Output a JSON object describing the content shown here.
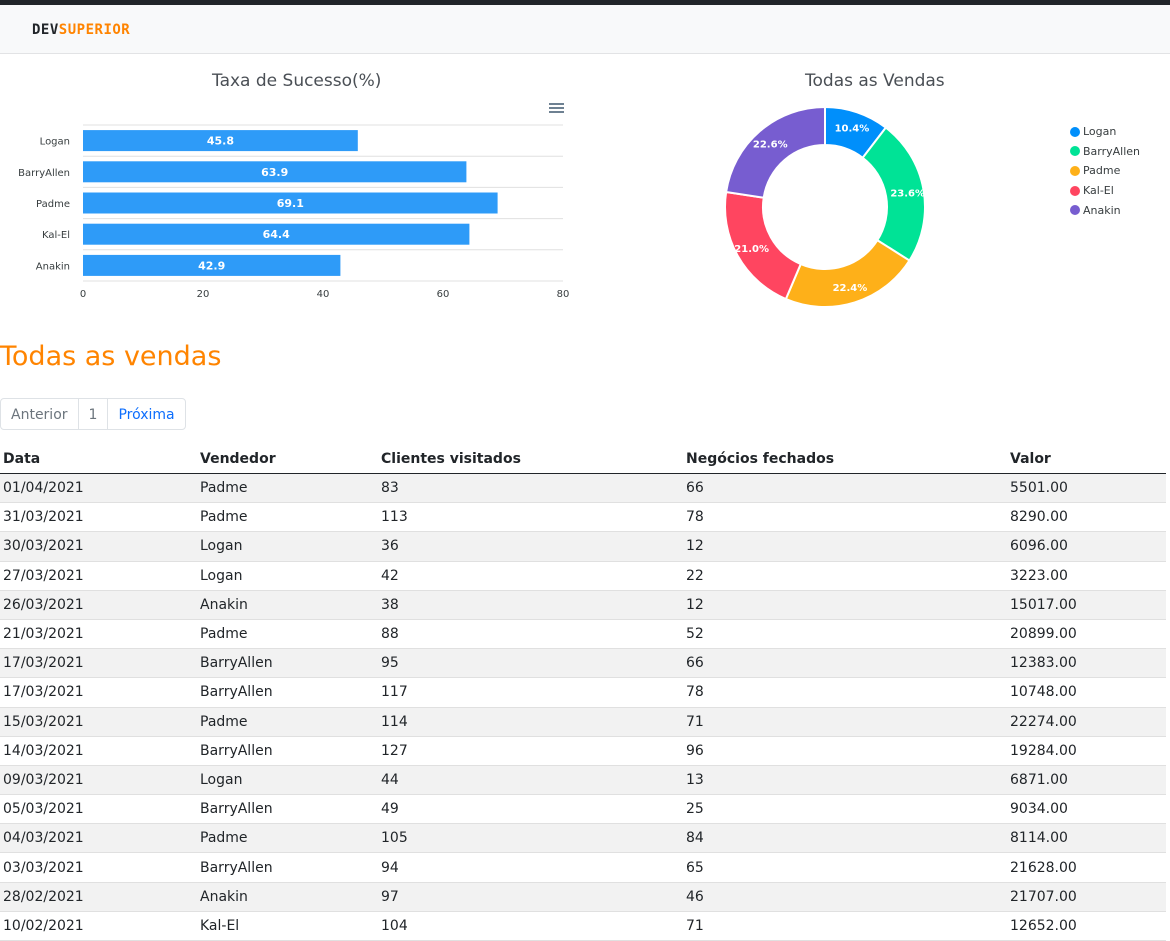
{
  "brand": {
    "part1": "DEV",
    "part2": "SUPERIOR"
  },
  "colors": {
    "accent": "#ff8400",
    "bar": "#2e9bf8"
  },
  "bar_menu_icon": "hamburger-menu-icon",
  "chart_data": [
    {
      "type": "bar",
      "orientation": "horizontal",
      "title": "Taxa de Sucesso(%)",
      "categories": [
        "Logan",
        "BarryAllen",
        "Padme",
        "Kal-El",
        "Anakin"
      ],
      "values": [
        45.8,
        63.9,
        69.1,
        64.4,
        42.9
      ],
      "xlim": [
        0,
        80
      ],
      "xticks": [
        "0",
        "20",
        "40",
        "60",
        "80"
      ],
      "grid": true
    },
    {
      "type": "pie",
      "variant": "donut",
      "title": "Todas as Vendas",
      "labels": [
        "Logan",
        "BarryAllen",
        "Padme",
        "Kal-El",
        "Anakin"
      ],
      "values": [
        10.4,
        23.6,
        22.4,
        21.0,
        22.6
      ],
      "value_labels": [
        "10.4%",
        "23.6%",
        "22.4%",
        "21.0%",
        "22.6%"
      ],
      "colors": [
        "#008ffb",
        "#00e396",
        "#feb019",
        "#ff4560",
        "#775dd0"
      ],
      "legend": "right"
    }
  ],
  "section_title": "Todas as vendas",
  "pagination": {
    "prev": "Anterior",
    "page": "1",
    "next": "Próxima"
  },
  "table": {
    "headers": [
      "Data",
      "Vendedor",
      "Clientes visitados",
      "Negócios fechados",
      "Valor"
    ],
    "rows": [
      [
        "01/04/2021",
        "Padme",
        "83",
        "66",
        "5501.00"
      ],
      [
        "31/03/2021",
        "Padme",
        "113",
        "78",
        "8290.00"
      ],
      [
        "30/03/2021",
        "Logan",
        "36",
        "12",
        "6096.00"
      ],
      [
        "27/03/2021",
        "Logan",
        "42",
        "22",
        "3223.00"
      ],
      [
        "26/03/2021",
        "Anakin",
        "38",
        "12",
        "15017.00"
      ],
      [
        "21/03/2021",
        "Padme",
        "88",
        "52",
        "20899.00"
      ],
      [
        "17/03/2021",
        "BarryAllen",
        "95",
        "66",
        "12383.00"
      ],
      [
        "17/03/2021",
        "BarryAllen",
        "117",
        "78",
        "10748.00"
      ],
      [
        "15/03/2021",
        "Padme",
        "114",
        "71",
        "22274.00"
      ],
      [
        "14/03/2021",
        "BarryAllen",
        "127",
        "96",
        "19284.00"
      ],
      [
        "09/03/2021",
        "Logan",
        "44",
        "13",
        "6871.00"
      ],
      [
        "05/03/2021",
        "BarryAllen",
        "49",
        "25",
        "9034.00"
      ],
      [
        "04/03/2021",
        "Padme",
        "105",
        "84",
        "8114.00"
      ],
      [
        "03/03/2021",
        "BarryAllen",
        "94",
        "65",
        "21628.00"
      ],
      [
        "28/02/2021",
        "Anakin",
        "97",
        "46",
        "21707.00"
      ],
      [
        "10/02/2021",
        "Kal-El",
        "104",
        "71",
        "12652.00"
      ]
    ]
  }
}
